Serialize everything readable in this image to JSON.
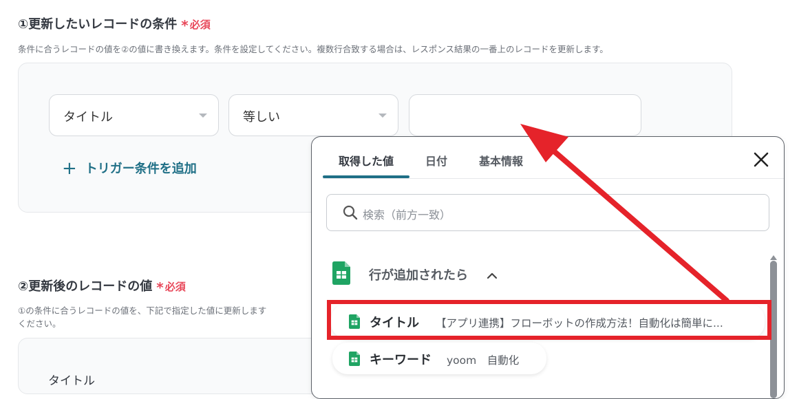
{
  "section1": {
    "title": "①更新したいレコードの条件",
    "required_star": "*",
    "required_label": "必須",
    "description": "条件に合うレコードの値を②の値に書き換えます。条件を設定してください。複数行合致する場合は、レスポンス結果の一番上のレコードを更新します。",
    "field_select": "タイトル",
    "operator_select": "等しい",
    "value_input": "",
    "add_trigger_icon": "plus-icon",
    "add_trigger_label": "トリガー条件を追加"
  },
  "section2": {
    "title": "②更新後のレコードの値",
    "required_star": "*",
    "required_label": "必須",
    "description_line1": "①の条件に合うレコードの値を、下記で指定した値に更新します",
    "description_line2": "ください。",
    "field_label": "タイトル"
  },
  "popup": {
    "tabs": [
      {
        "label": "取得した値",
        "active": true
      },
      {
        "label": "日付",
        "active": false
      },
      {
        "label": "基本情報",
        "active": false
      }
    ],
    "close_icon": "close-icon",
    "search_placeholder": "検索（前方一致）",
    "group": {
      "icon": "google-sheets-icon",
      "label": "行が追加されたら",
      "toggle_icon": "chevron-up-icon"
    },
    "items": [
      {
        "key": "タイトル",
        "value": "【アプリ連携】フローボットの作成方法！自動化は簡単に..."
      },
      {
        "key": "キーワード",
        "value": "yoom　自動化"
      }
    ]
  },
  "colors": {
    "accent": "#1f6f86",
    "required": "#e8485a",
    "annotation": "#e5232a",
    "sheets_green": "#1fa463"
  }
}
